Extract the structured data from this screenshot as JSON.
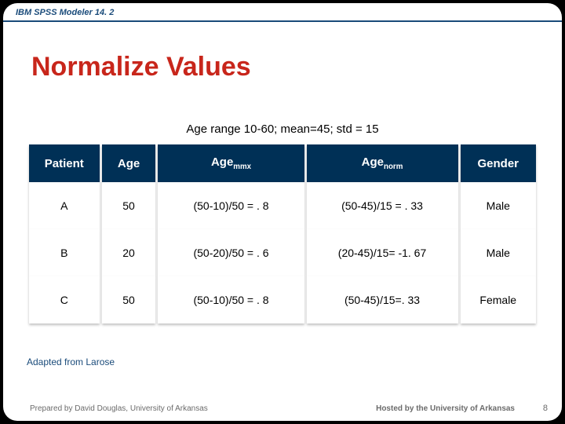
{
  "brand": "IBM SPSS Modeler 14. 2",
  "title": "Normalize Values",
  "subtitle": "Age range 10-60; mean=45; std = 15",
  "headers": {
    "patient": "Patient",
    "age": "Age",
    "agemmx_base": "Age",
    "agemmx_sub": "mmx",
    "agenorm_base": "Age",
    "agenorm_sub": "norm",
    "gender": "Gender"
  },
  "rows": [
    {
      "patient": "A",
      "age": "50",
      "mmx": "(50-10)/50 = . 8",
      "norm": "(50-45)/15 = . 33",
      "gender": "Male"
    },
    {
      "patient": "B",
      "age": "20",
      "mmx": "(50-20)/50 = . 6",
      "norm": "(20-45)/15= -1. 67",
      "gender": "Male"
    },
    {
      "patient": "C",
      "age": "50",
      "mmx": "(50-10)/50 = . 8",
      "norm": "(50-45)/15=. 33",
      "gender": "Female"
    }
  ],
  "attrib": "Adapted from Larose",
  "footer_left": "Prepared by David Douglas, University of Arkansas",
  "footer_right": "Hosted by the University of Arkansas",
  "page": "8"
}
